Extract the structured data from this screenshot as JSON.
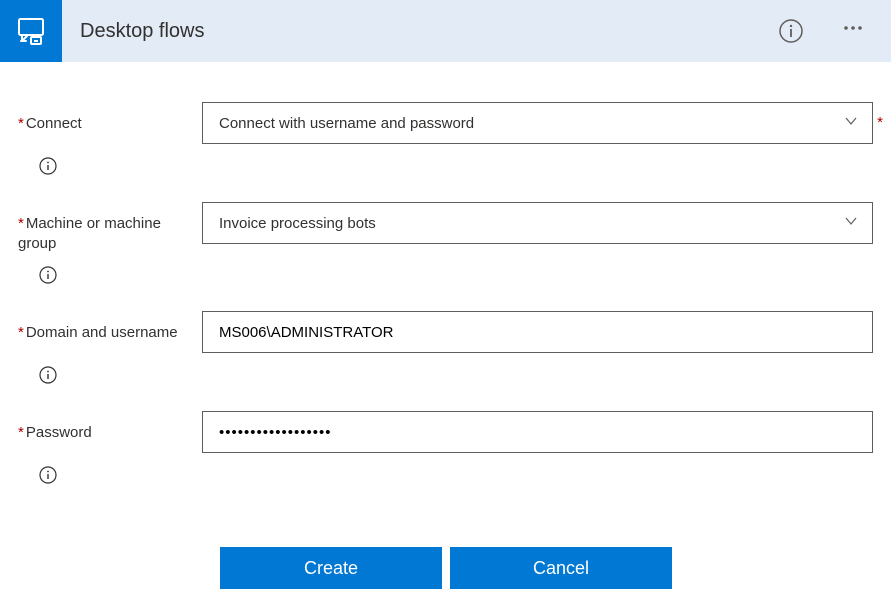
{
  "header": {
    "title": "Desktop flows"
  },
  "fields": {
    "connect": {
      "label": "Connect",
      "value": "Connect with username and password"
    },
    "machine": {
      "label": "Machine or machine group",
      "value": "Invoice processing bots"
    },
    "domain": {
      "label": "Domain and username",
      "value": "MS006\\ADMINISTRATOR"
    },
    "password": {
      "label": "Password",
      "value": "••••••••••••••••••"
    }
  },
  "buttons": {
    "create": "Create",
    "cancel": "Cancel"
  }
}
